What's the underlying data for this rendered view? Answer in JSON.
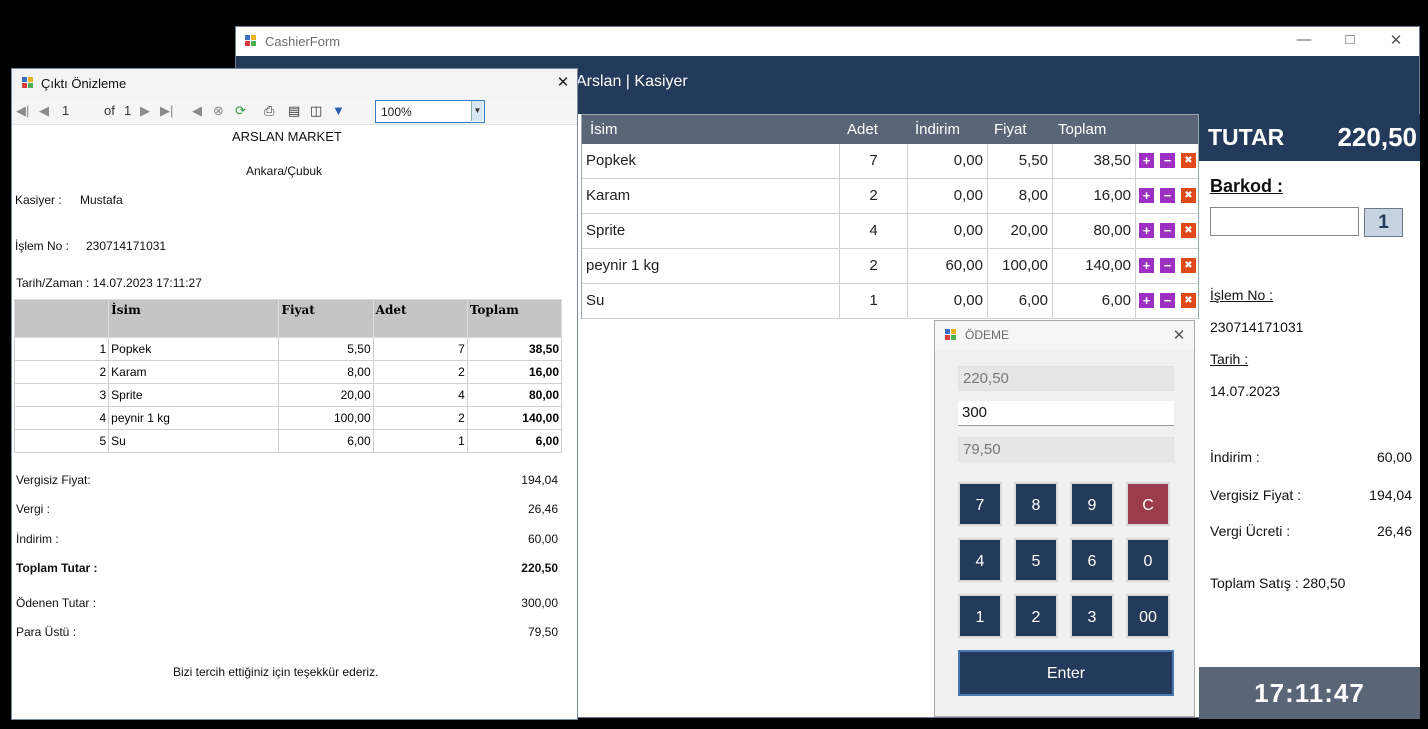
{
  "cashier": {
    "window_title": "CashierForm",
    "user_label": "Arslan | Kasiyer",
    "grid": {
      "columns": [
        "İsim",
        "Adet",
        "İndirim",
        "Fiyat",
        "Toplam"
      ],
      "rows": [
        {
          "isim": "Popkek",
          "adet": "7",
          "indirim": "0,00",
          "fiyat": "5,50",
          "toplam": "38,50"
        },
        {
          "isim": "Karam",
          "adet": "2",
          "indirim": "0,00",
          "fiyat": "8,00",
          "toplam": "16,00"
        },
        {
          "isim": "Sprite",
          "adet": "4",
          "indirim": "0,00",
          "fiyat": "20,00",
          "toplam": "80,00"
        },
        {
          "isim": "peynir 1 kg",
          "adet": "2",
          "indirim": "60,00",
          "fiyat": "100,00",
          "toplam": "140,00"
        },
        {
          "isim": "Su",
          "adet": "1",
          "indirim": "0,00",
          "fiyat": "6,00",
          "toplam": "6,00"
        }
      ]
    },
    "right_panel": {
      "tutar_label": "TUTAR",
      "tutar_value": "220,50",
      "barkod_label": "Barkod :",
      "barkod_value": "",
      "barkod_button": "1",
      "islem_no_label": "İşlem No :",
      "islem_no_value": "230714171031",
      "tarih_label": "Tarih :",
      "tarih_value": "14.07.2023",
      "indirim_label": "İndirim :",
      "indirim_value": "60,00",
      "vergisiz_label": "Vergisiz Fiyat :",
      "vergisiz_value": "194,04",
      "vergi_label": "Vergi Ücreti :",
      "vergi_value": "26,46",
      "toplam_satis": "Toplam Satış : 280,50",
      "clock": "17:11:47"
    }
  },
  "odeme": {
    "title": "ÖDEME",
    "total": "220,50",
    "paid": "300",
    "change": "79,50",
    "keys": [
      "7",
      "8",
      "9",
      "C",
      "4",
      "5",
      "6",
      "0",
      "1",
      "2",
      "3",
      "00"
    ],
    "enter": "Enter"
  },
  "preview": {
    "title": "Çıktı Önizleme",
    "page_current": "1",
    "page_of": "of",
    "page_total": "1",
    "zoom": "100%",
    "report": {
      "store": "ARSLAN MARKET",
      "city": "Ankara/Çubuk",
      "kasiyer_label": "Kasiyer :",
      "kasiyer_value": "Mustafa",
      "islem_label": "İşlem No :",
      "islem_value": "230714171031",
      "tarih_text": "Tarih/Zaman : 14.07.2023 17:11:27",
      "columns": [
        "İsim",
        "Fiyat",
        "Adet",
        "Toplam"
      ],
      "rows": [
        {
          "no": "1",
          "isim": "Popkek",
          "fiyat": "5,50",
          "adet": "7",
          "toplam": "38,50"
        },
        {
          "no": "2",
          "isim": "Karam",
          "fiyat": "8,00",
          "adet": "2",
          "toplam": "16,00"
        },
        {
          "no": "3",
          "isim": "Sprite",
          "fiyat": "20,00",
          "adet": "4",
          "toplam": "80,00"
        },
        {
          "no": "4",
          "isim": "peynir 1 kg",
          "fiyat": "100,00",
          "adet": "2",
          "toplam": "140,00"
        },
        {
          "no": "5",
          "isim": "Su",
          "fiyat": "6,00",
          "adet": "1",
          "toplam": "6,00"
        }
      ],
      "vergisiz_label": "Vergisiz Fiyat:",
      "vergisiz_value": "194,04",
      "vergi_label": "Vergi :",
      "vergi_value": "26,46",
      "indirim_label": "İndirim :",
      "indirim_value": "60,00",
      "toplam_label": "Toplam Tutar :",
      "toplam_value": "220,50",
      "odenen_label": "Ödenen Tutar :",
      "odenen_value": "300,00",
      "para_label": "Para Üstü :",
      "para_value": "79,50",
      "thanks": "Bizi tercih ettiğiniz için teşekkür ederiz."
    }
  }
}
